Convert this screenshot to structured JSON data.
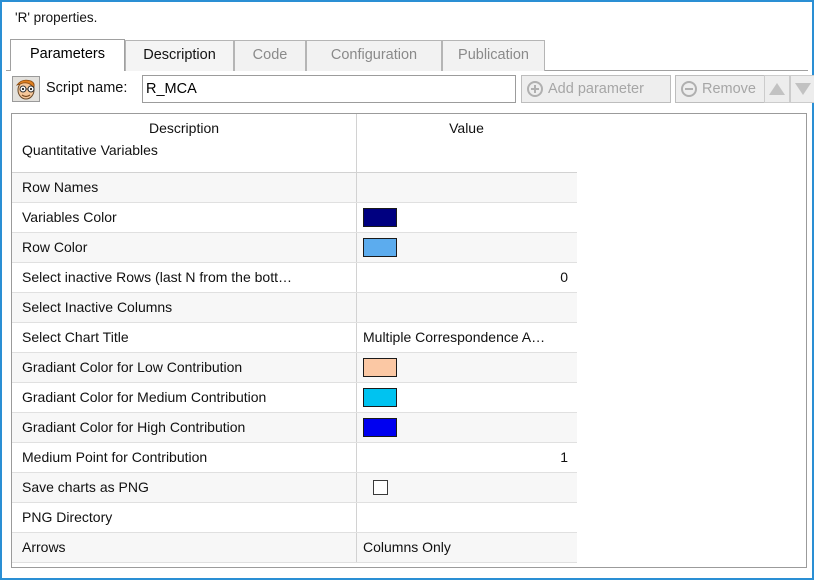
{
  "window": {
    "title": "'R' properties.",
    "border_color": "#2a8fd4"
  },
  "tabs": [
    {
      "label": "Parameters",
      "state": "selected"
    },
    {
      "label": "Description",
      "state": "enabled"
    },
    {
      "label": "Code",
      "state": "disabled"
    },
    {
      "label": "Configuration",
      "state": "disabled"
    },
    {
      "label": "Publication",
      "state": "disabled"
    }
  ],
  "toolbar": {
    "script_icon": "script-face-icon",
    "script_label": "Script name:",
    "script_value": "R_MCA",
    "add_parameter_label": "Add parameter",
    "remove_label": "Remove",
    "move_up_label": "Move up",
    "move_down_label": "Move down",
    "add_parameter_enabled": false,
    "remove_enabled": false,
    "move_enabled": false
  },
  "grid": {
    "columns": [
      "Description",
      "Value"
    ],
    "first_row_label": "Quantitative Variables",
    "first_row_value": "",
    "rows": [
      {
        "description": "Row Names",
        "type": "text",
        "value": ""
      },
      {
        "description": "Variables Color",
        "type": "color",
        "value": "#000080"
      },
      {
        "description": "Row Color",
        "type": "color",
        "value": "#5CACEE"
      },
      {
        "description": "Select inactive Rows (last N from the bott…",
        "type": "number",
        "value": "0"
      },
      {
        "description": "Select Inactive Columns",
        "type": "text",
        "value": ""
      },
      {
        "description": "Select Chart Title",
        "type": "text",
        "value": "Multiple Correspondence A…"
      },
      {
        "description": "Gradiant Color for Low Contribution",
        "type": "color",
        "value": "#FBC8A4"
      },
      {
        "description": "Gradiant Color for Medium Contribution",
        "type": "color",
        "value": "#00C3F0"
      },
      {
        "description": "Gradiant Color for High Contribution",
        "type": "color",
        "value": "#0000F0"
      },
      {
        "description": "Medium Point for Contribution",
        "type": "number",
        "value": "1"
      },
      {
        "description": "Save charts as PNG",
        "type": "checkbox",
        "value": "",
        "checked": false
      },
      {
        "description": "PNG Directory",
        "type": "text",
        "value": ""
      },
      {
        "description": "Arrows",
        "type": "text",
        "value": "Columns Only"
      }
    ]
  }
}
